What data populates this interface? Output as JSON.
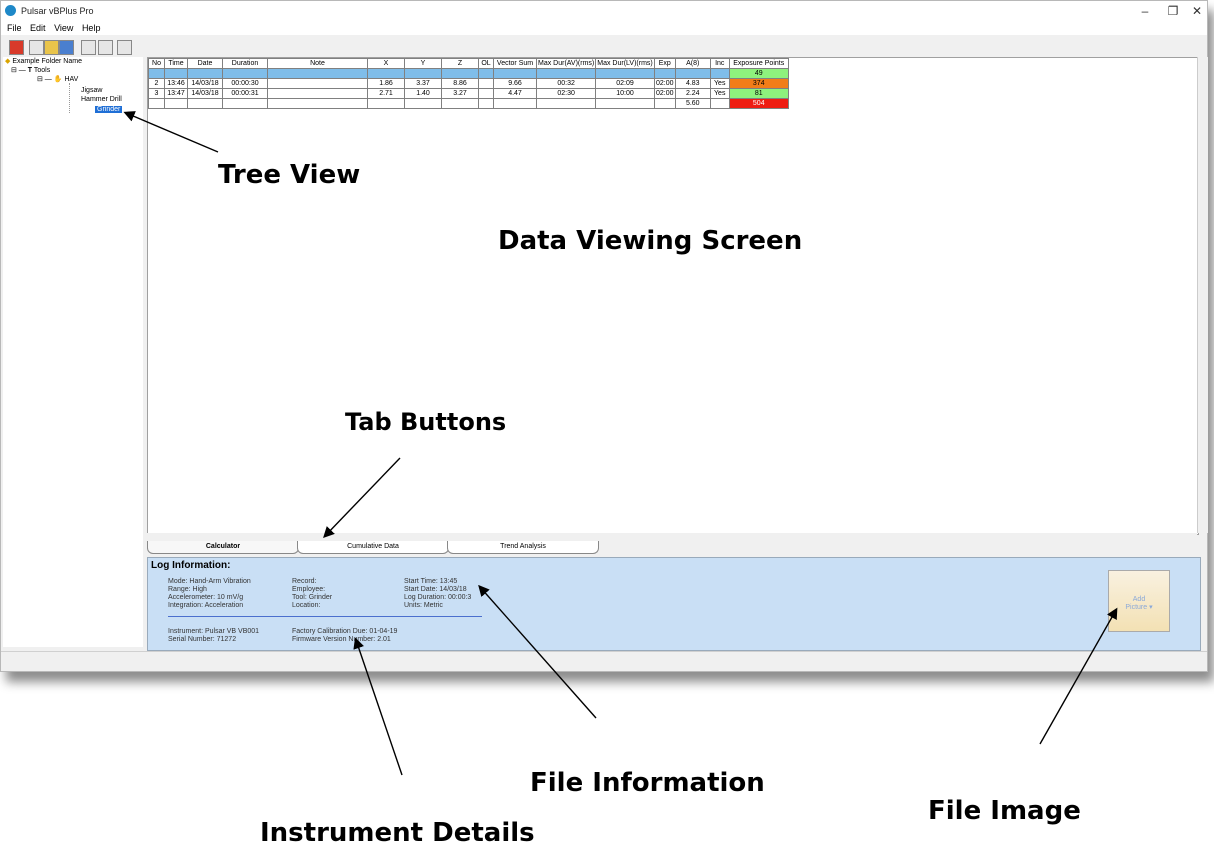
{
  "window": {
    "title": "Pulsar vBPlus Pro",
    "controls": [
      "–",
      "❐",
      "✕"
    ]
  },
  "menu": [
    "File",
    "Edit",
    "View",
    "Help"
  ],
  "toolbar": {
    "icons": [
      "open-log-icon",
      "new-file-icon",
      "open-folder-icon",
      "save-icon",
      "copy-icon",
      "print-icon",
      "home-icon"
    ]
  },
  "tree": {
    "root": "Example Folder Name",
    "tools": "Tools",
    "hav": "HAV",
    "items": [
      "Jigsaw",
      "Hammer Drill",
      "Grinder"
    ],
    "selected": "Grinder"
  },
  "table": {
    "headers": [
      "No",
      "Time",
      "Date",
      "Duration",
      "Note",
      "X",
      "Y",
      "Z",
      "OL",
      "Vector Sum",
      "Max Dur(AV)(rms)",
      "Max Dur(LV)(rms)",
      "Exp",
      "A(8)",
      "Inc",
      "Exposure Points"
    ],
    "rows": [
      [
        "",
        "",
        "",
        "",
        "",
        "",
        "",
        "",
        "",
        "",
        "",
        "",
        "",
        "",
        "",
        "49"
      ],
      [
        "2",
        "13:46",
        "14/03/18",
        "00:00:30",
        "",
        "1.86",
        "3.37",
        "8.86",
        "",
        "9.66",
        "00:32",
        "02:09",
        "02:00",
        "4.83",
        "Yes",
        "374"
      ],
      [
        "3",
        "13:47",
        "14/03/18",
        "00:00:31",
        "",
        "2.71",
        "1.40",
        "3.27",
        "",
        "4.47",
        "02:30",
        "10:00",
        "02:00",
        "2.24",
        "Yes",
        "81"
      ],
      [
        "",
        "",
        "",
        "",
        "",
        "",
        "",
        "",
        "",
        "",
        "",
        "",
        "",
        "5.60",
        "",
        "504"
      ]
    ]
  },
  "tabs": [
    "Calculator",
    "Cumulative Data",
    "Trend Analysis"
  ],
  "log": {
    "title": "Log Information:",
    "mode": "Mode: Hand-Arm Vibration",
    "range": "Range: High",
    "accelerometer": "Accelerometer: 10  mV/g",
    "integration": "Integration: Acceleration",
    "record": "Record:",
    "employee": "Employee:",
    "tool": "Tool: Grinder",
    "location": "Location:",
    "start_time": "Start Time: 13:45",
    "start_date": "Start Date: 14/03/18",
    "log_duration": "Log Duration: 00:00:3",
    "units": "Units: Metric",
    "instrument": "Instrument: Pulsar VB VB001",
    "serial": "Serial Number: 71272",
    "calibration": "Factory Calibration Due: 01-04-19",
    "firmware": "Firmware Version Number:  2.01"
  },
  "add_picture": {
    "line1": "Add",
    "line2": "Picture ▾"
  },
  "annotations": {
    "tree_view": "Tree View",
    "data_viewing": "Data Viewing Screen",
    "tab_buttons": "Tab Buttons",
    "file_information": "File Information",
    "file_image": "File Image",
    "instrument_details": "Instrument Details"
  }
}
